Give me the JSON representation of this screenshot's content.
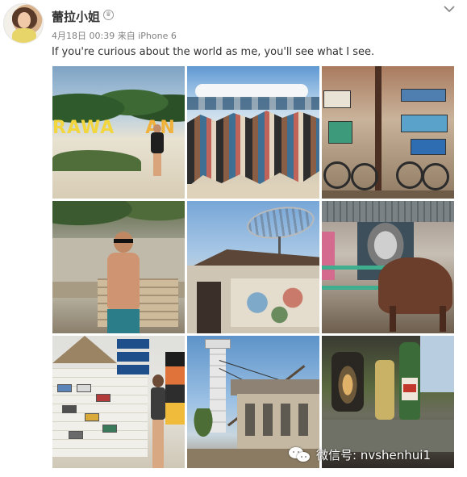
{
  "post": {
    "username": "蕾拉小姐",
    "verified_badge_icon": "crown-badge-icon",
    "menu_icon": "chevron-down-icon",
    "date": "4月18日 00:39",
    "source_prefix": "来自",
    "source": "iPhone 6",
    "text": "If you're curious about the world as me, you'll see what I see.",
    "photos": [
      {
        "label": "RAWA",
        "label2": "AN",
        "icon": "beach-sign-photo"
      },
      {
        "icon": "beach-crowd-photo"
      },
      {
        "icon": "bicycles-signs-photo"
      },
      {
        "icon": "man-by-wall-photo"
      },
      {
        "icon": "satellite-dish-house-photo"
      },
      {
        "icon": "horse-mural-photo"
      },
      {
        "icon": "sign-wall-photo"
      },
      {
        "icon": "lighthouse-photo"
      },
      {
        "icon": "lantern-bottle-photo"
      }
    ]
  },
  "watermark": {
    "icon": "wechat-icon",
    "text": "微信号: nvshenhui1"
  },
  "colors": {
    "username": "#333333",
    "meta": "#808080",
    "text": "#333333"
  }
}
